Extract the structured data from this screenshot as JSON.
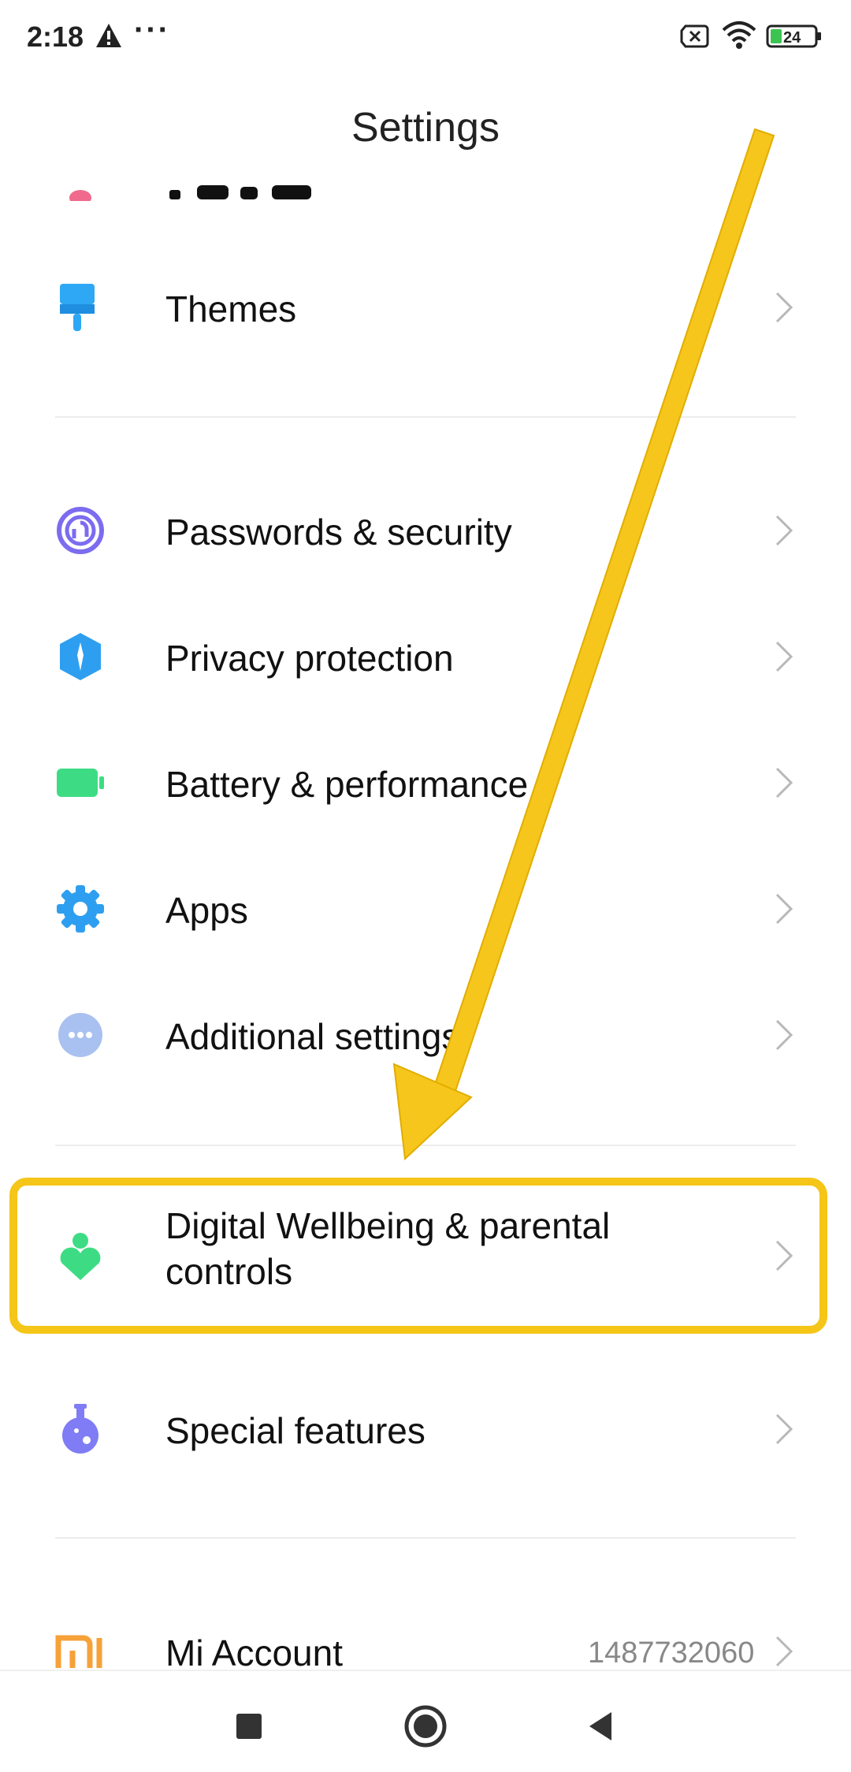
{
  "status_bar": {
    "time": "2:18",
    "battery_level": "24",
    "icons": [
      "warning-icon",
      "more-dots-icon",
      "no-sim-icon",
      "wifi-icon",
      "battery-icon"
    ]
  },
  "header": {
    "title": "Settings"
  },
  "settings": {
    "items": [
      {
        "id": "themes",
        "label": "Themes",
        "icon": "brush-icon",
        "icon_color": "#2ea8f5"
      },
      {
        "id": "passwords",
        "label": "Passwords & security",
        "icon": "fingerprint-icon",
        "icon_color": "#7b6cf0"
      },
      {
        "id": "privacy",
        "label": "Privacy protection",
        "icon": "privacy-shield-icon",
        "icon_color": "#2e9ff0"
      },
      {
        "id": "battery",
        "label": "Battery & performance",
        "icon": "battery-performance-icon",
        "icon_color": "#3ddc84"
      },
      {
        "id": "apps",
        "label": "Apps",
        "icon": "gear-icon",
        "icon_color": "#2e9ff0"
      },
      {
        "id": "additional",
        "label": "Additional settings",
        "icon": "more-circle-icon",
        "icon_color": "#a9c1f0"
      },
      {
        "id": "wellbeing",
        "label_line1": "Digital Wellbeing & parental",
        "label_line2": "controls",
        "icon": "wellbeing-heart-icon",
        "icon_color": "#3ddc84"
      },
      {
        "id": "special",
        "label": "Special features",
        "icon": "flask-icon",
        "icon_color": "#7f7cf5"
      },
      {
        "id": "mi_account",
        "label": "Mi Account",
        "value": "1487732060",
        "icon": "mi-logo-icon",
        "icon_color": "#f7a139"
      }
    ]
  },
  "annotation": {
    "highlight_color": "#f5c518",
    "arrow_color": "#f5c518"
  },
  "nav_bar": {
    "buttons": [
      "recents-button",
      "home-button",
      "back-button"
    ]
  }
}
